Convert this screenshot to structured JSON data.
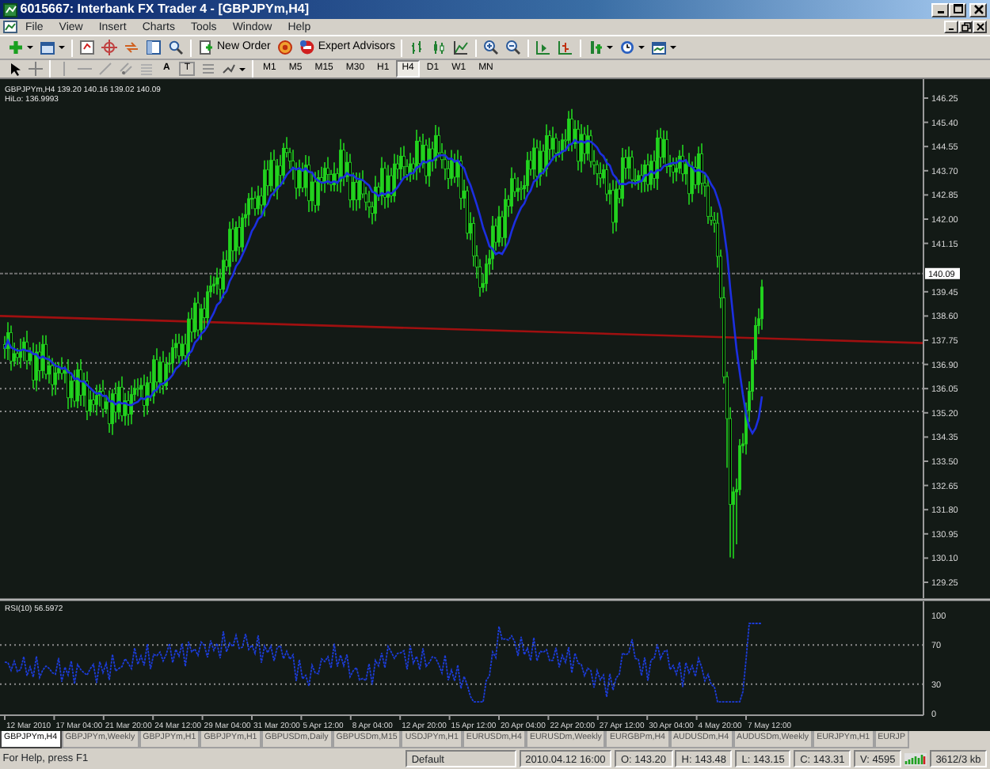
{
  "window": {
    "title": "6015667: Interbank FX Trader 4 - [GBPJPYm,H4]"
  },
  "menu": [
    "File",
    "View",
    "Insert",
    "Charts",
    "Tools",
    "Window",
    "Help"
  ],
  "toolbar": {
    "new_order": "New Order",
    "expert_advisors": "Expert Advisors",
    "text_tool": "A",
    "label_tool": "T"
  },
  "timeframes": [
    {
      "label": "M1",
      "selected": false
    },
    {
      "label": "M5",
      "selected": false
    },
    {
      "label": "M15",
      "selected": false
    },
    {
      "label": "M30",
      "selected": false
    },
    {
      "label": "H1",
      "selected": false
    },
    {
      "label": "H4",
      "selected": true
    },
    {
      "label": "D1",
      "selected": false
    },
    {
      "label": "W1",
      "selected": false
    },
    {
      "label": "MN",
      "selected": false
    }
  ],
  "chart": {
    "header": "GBPJPYm,H4 139.20 140.16 139.02 140.09",
    "indicator": "HiLo: 136.9993",
    "current_price": "140.09",
    "price_labels": [
      "146.25",
      "145.40",
      "144.55",
      "143.70",
      "142.85",
      "142.00",
      "141.15",
      "139.45",
      "138.60",
      "137.75",
      "136.90",
      "136.05",
      "135.20",
      "134.35",
      "133.50",
      "132.65",
      "131.80",
      "130.95",
      "130.10",
      "129.25"
    ]
  },
  "rsi": {
    "title": "RSI(10) 56.5972",
    "levels": [
      "100",
      "70",
      "30",
      "0"
    ]
  },
  "time_labels": [
    "12 Mar 2010",
    "17 Mar 04:00",
    "21 Mar 20:00",
    "24 Mar 12:00",
    "29 Mar 04:00",
    "31 Mar 20:00",
    "5 Apr 12:00",
    "8 Apr 04:00",
    "12 Apr 20:00",
    "15 Apr 12:00",
    "20 Apr 04:00",
    "22 Apr 20:00",
    "27 Apr 12:00",
    "30 Apr 04:00",
    "4 May 20:00",
    "7 May 12:00"
  ],
  "tabs": [
    {
      "label": "GBPJPYm,H4",
      "selected": true
    },
    {
      "label": "GBPJPYm,Weekly",
      "selected": false
    },
    {
      "label": "GBPJPYm,H1",
      "selected": false
    },
    {
      "label": "GBPJPYm,H1",
      "selected": false
    },
    {
      "label": "GBPUSDm,Daily",
      "selected": false
    },
    {
      "label": "GBPUSDm,M15",
      "selected": false
    },
    {
      "label": "USDJPYm,H1",
      "selected": false
    },
    {
      "label": "EURUSDm,H4",
      "selected": false
    },
    {
      "label": "EURUSDm,Weekly",
      "selected": false
    },
    {
      "label": "EURGBPm,H4",
      "selected": false
    },
    {
      "label": "AUDUSDm,H4",
      "selected": false
    },
    {
      "label": "AUDUSDm,Weekly",
      "selected": false
    },
    {
      "label": "EURJPYm,H1",
      "selected": false
    },
    {
      "label": "EURJP",
      "selected": false
    }
  ],
  "status_bar": {
    "help": "For Help, press F1",
    "profile": "Default",
    "time": "2010.04.12 16:00",
    "open": "O: 143.20",
    "high": "H: 143.48",
    "low": "L: 143.15",
    "close": "C: 143.31",
    "volume": "V: 4595",
    "traffic": "3612/3 kb"
  }
}
